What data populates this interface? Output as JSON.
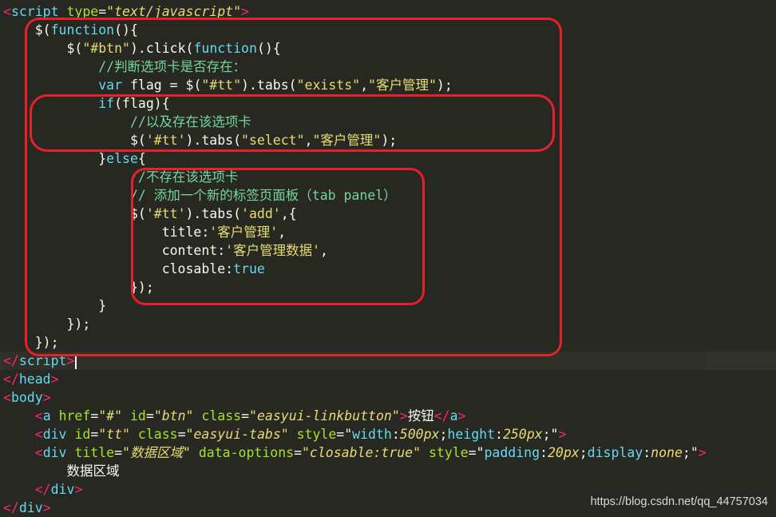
{
  "lines": [
    {
      "indent": "",
      "tokens": [
        {
          "c": "tag",
          "t": "<"
        },
        {
          "c": "kw",
          "t": "script "
        },
        {
          "c": "attr",
          "t": "type"
        },
        {
          "c": "pl",
          "t": "="
        },
        {
          "c": "istr",
          "t": "\"text/javascript\""
        },
        {
          "c": "tag",
          "t": ">"
        }
      ]
    },
    {
      "indent": "    ",
      "tokens": [
        {
          "c": "pl",
          "t": "$("
        },
        {
          "c": "kw",
          "t": "function"
        },
        {
          "c": "pl",
          "t": "(){"
        }
      ]
    },
    {
      "indent": "        ",
      "tokens": [
        {
          "c": "pl",
          "t": "$("
        },
        {
          "c": "str",
          "t": "\"#btn\""
        },
        {
          "c": "pl",
          "t": ").click("
        },
        {
          "c": "kw",
          "t": "function"
        },
        {
          "c": "pl",
          "t": "(){"
        }
      ]
    },
    {
      "indent": "            ",
      "tokens": [
        {
          "c": "cm",
          "t": "//判断选项卡是否存在："
        }
      ]
    },
    {
      "indent": "            ",
      "tokens": [
        {
          "c": "var",
          "t": "var "
        },
        {
          "c": "pl",
          "t": "flag = $("
        },
        {
          "c": "str",
          "t": "\"#tt\""
        },
        {
          "c": "pl",
          "t": ").tabs("
        },
        {
          "c": "str",
          "t": "\"exists\""
        },
        {
          "c": "pl",
          "t": ","
        },
        {
          "c": "str",
          "t": "\"客户管理\""
        },
        {
          "c": "pl",
          "t": ");"
        }
      ]
    },
    {
      "indent": "            ",
      "tokens": [
        {
          "c": "kw",
          "t": "if"
        },
        {
          "c": "pl",
          "t": "(flag){"
        }
      ]
    },
    {
      "indent": "                ",
      "tokens": [
        {
          "c": "cm",
          "t": "//以及存在该选项卡"
        }
      ]
    },
    {
      "indent": "                ",
      "tokens": [
        {
          "c": "pl",
          "t": "$("
        },
        {
          "c": "str",
          "t": "'#tt'"
        },
        {
          "c": "pl",
          "t": ").tabs("
        },
        {
          "c": "str",
          "t": "\"select\""
        },
        {
          "c": "pl",
          "t": ","
        },
        {
          "c": "str",
          "t": "\"客户管理\""
        },
        {
          "c": "pl",
          "t": ");"
        }
      ]
    },
    {
      "indent": "            ",
      "tokens": [
        {
          "c": "pl",
          "t": "}"
        },
        {
          "c": "kw",
          "t": "else"
        },
        {
          "c": "pl",
          "t": "{"
        }
      ]
    },
    {
      "indent": "                ",
      "tokens": [
        {
          "c": "cm",
          "t": "//不存在该选项卡"
        }
      ]
    },
    {
      "indent": "                ",
      "tokens": [
        {
          "c": "cm",
          "t": "// 添加一个新的标签页面板（tab panel）"
        }
      ]
    },
    {
      "indent": "                ",
      "tokens": [
        {
          "c": "pl",
          "t": "$("
        },
        {
          "c": "str",
          "t": "'#tt'"
        },
        {
          "c": "pl",
          "t": ").tabs("
        },
        {
          "c": "str",
          "t": "'add'"
        },
        {
          "c": "pl",
          "t": ",{"
        }
      ]
    },
    {
      "indent": "                    ",
      "tokens": [
        {
          "c": "pl",
          "t": "title:"
        },
        {
          "c": "str",
          "t": "'客户管理'"
        },
        {
          "c": "pl",
          "t": ","
        }
      ]
    },
    {
      "indent": "                    ",
      "tokens": [
        {
          "c": "pl",
          "t": "content:"
        },
        {
          "c": "str",
          "t": "'客户管理数据'"
        },
        {
          "c": "pl",
          "t": ","
        }
      ]
    },
    {
      "indent": "                    ",
      "tokens": [
        {
          "c": "pl",
          "t": "closable:"
        },
        {
          "c": "bool",
          "t": "true"
        }
      ]
    },
    {
      "indent": "                ",
      "tokens": [
        {
          "c": "pl",
          "t": "});"
        }
      ]
    },
    {
      "indent": "            ",
      "tokens": [
        {
          "c": "pl",
          "t": "}"
        }
      ]
    },
    {
      "indent": "        ",
      "tokens": [
        {
          "c": "pl",
          "t": "});"
        }
      ]
    },
    {
      "indent": "    ",
      "tokens": [
        {
          "c": "pl",
          "t": "});"
        }
      ]
    },
    {
      "indent": "",
      "hl": true,
      "cursor": true,
      "tokens": [
        {
          "c": "tag",
          "t": "</"
        },
        {
          "c": "kw",
          "t": "script"
        },
        {
          "c": "tag",
          "t": ">"
        }
      ]
    },
    {
      "indent": "",
      "tokens": [
        {
          "c": "tag",
          "t": "</"
        },
        {
          "c": "kw",
          "t": "head"
        },
        {
          "c": "tag",
          "t": ">"
        }
      ]
    },
    {
      "indent": "",
      "tokens": [
        {
          "c": "tag",
          "t": "<"
        },
        {
          "c": "kw",
          "t": "body"
        },
        {
          "c": "tag",
          "t": ">"
        }
      ]
    },
    {
      "indent": "    ",
      "tokens": [
        {
          "c": "tag",
          "t": "<"
        },
        {
          "c": "kw",
          "t": "a "
        },
        {
          "c": "attr",
          "t": "href"
        },
        {
          "c": "pl",
          "t": "="
        },
        {
          "c": "istr",
          "t": "\"#\""
        },
        {
          "c": "attr",
          "t": " id"
        },
        {
          "c": "pl",
          "t": "="
        },
        {
          "c": "istr",
          "t": "\"btn\""
        },
        {
          "c": "attr",
          "t": " class"
        },
        {
          "c": "pl",
          "t": "="
        },
        {
          "c": "istr",
          "t": "\"easyui-linkbutton\""
        },
        {
          "c": "tag",
          "t": ">"
        },
        {
          "c": "pl",
          "t": "按钮"
        },
        {
          "c": "tag",
          "t": "</"
        },
        {
          "c": "kw",
          "t": "a"
        },
        {
          "c": "tag",
          "t": ">"
        }
      ]
    },
    {
      "indent": "    ",
      "tokens": [
        {
          "c": "tag",
          "t": "<"
        },
        {
          "c": "kw",
          "t": "div "
        },
        {
          "c": "attr",
          "t": "id"
        },
        {
          "c": "pl",
          "t": "="
        },
        {
          "c": "istr",
          "t": "\"tt\""
        },
        {
          "c": "attr",
          "t": " class"
        },
        {
          "c": "pl",
          "t": "="
        },
        {
          "c": "istr",
          "t": "\"easyui-tabs\""
        },
        {
          "c": "attr",
          "t": " style"
        },
        {
          "c": "pl",
          "t": "=\""
        },
        {
          "c": "kw",
          "t": "width"
        },
        {
          "c": "pl",
          "t": ":"
        },
        {
          "c": "istr",
          "t": "500px"
        },
        {
          "c": "pl",
          "t": ";"
        },
        {
          "c": "kw",
          "t": "height"
        },
        {
          "c": "pl",
          "t": ":"
        },
        {
          "c": "istr",
          "t": "250px"
        },
        {
          "c": "pl",
          "t": ";\""
        },
        {
          "c": "tag",
          "t": ">"
        }
      ]
    },
    {
      "indent": "    ",
      "tokens": [
        {
          "c": "tag",
          "t": "<"
        },
        {
          "c": "kw",
          "t": "div "
        },
        {
          "c": "attr",
          "t": "title"
        },
        {
          "c": "pl",
          "t": "="
        },
        {
          "c": "istr",
          "t": "\"数据区域\""
        },
        {
          "c": "attr",
          "t": " data-options"
        },
        {
          "c": "pl",
          "t": "="
        },
        {
          "c": "istr",
          "t": "\"closable:true\""
        },
        {
          "c": "attr",
          "t": " style"
        },
        {
          "c": "pl",
          "t": "=\""
        },
        {
          "c": "kw",
          "t": "padding"
        },
        {
          "c": "pl",
          "t": ":"
        },
        {
          "c": "istr",
          "t": "20px"
        },
        {
          "c": "pl",
          "t": ";"
        },
        {
          "c": "kw",
          "t": "display"
        },
        {
          "c": "pl",
          "t": ":"
        },
        {
          "c": "istr",
          "t": "none"
        },
        {
          "c": "pl",
          "t": ";\""
        },
        {
          "c": "tag",
          "t": ">"
        }
      ]
    },
    {
      "indent": "        ",
      "tokens": [
        {
          "c": "pl",
          "t": "数据区域"
        }
      ]
    },
    {
      "indent": "    ",
      "tokens": [
        {
          "c": "tag",
          "t": "</"
        },
        {
          "c": "kw",
          "t": "div"
        },
        {
          "c": "tag",
          "t": ">"
        }
      ]
    },
    {
      "indent": "",
      "tokens": [
        {
          "c": "tag",
          "t": "</"
        },
        {
          "c": "kw",
          "t": "div"
        },
        {
          "c": "tag",
          "t": ">"
        }
      ]
    }
  ],
  "watermark": "https://blog.csdn.net/qq_44757034"
}
